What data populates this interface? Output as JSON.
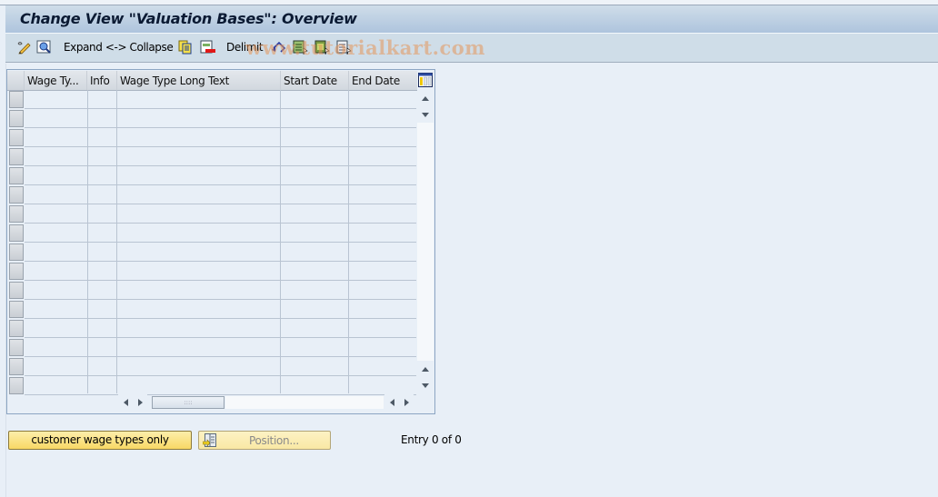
{
  "window": {
    "title": "Change View \"Valuation Bases\": Overview"
  },
  "toolbar": {
    "items": [
      {
        "icon": "change-display-icon"
      },
      {
        "icon": "find-icon"
      },
      {
        "label": "Expand <-> Collapse"
      },
      {
        "icon": "copy-icon"
      },
      {
        "icon": "delete-icon"
      },
      {
        "label": "Delimit"
      },
      {
        "icon": "undo-icon"
      },
      {
        "icon": "select-all-icon"
      },
      {
        "icon": "select-block-icon"
      },
      {
        "icon": "deselect-all-icon"
      }
    ],
    "expand_collapse_label": "Expand <-> Collapse",
    "delimit_label": "Delimit"
  },
  "watermark": "www.tutorialkart.com",
  "table": {
    "columns": [
      {
        "key": "wage_type",
        "label": "Wage Ty..."
      },
      {
        "key": "info",
        "label": "Info"
      },
      {
        "key": "long_text",
        "label": "Wage Type Long Text"
      },
      {
        "key": "start_date",
        "label": "Start Date"
      },
      {
        "key": "end_date",
        "label": "End Date"
      }
    ],
    "rows": [],
    "empty_row_count": 16,
    "column_settings_icon": "column-settings-icon"
  },
  "footer": {
    "customer_button_label": "customer wage types only",
    "position_button_label": "Position...",
    "entry_text": "Entry 0 of 0"
  }
}
